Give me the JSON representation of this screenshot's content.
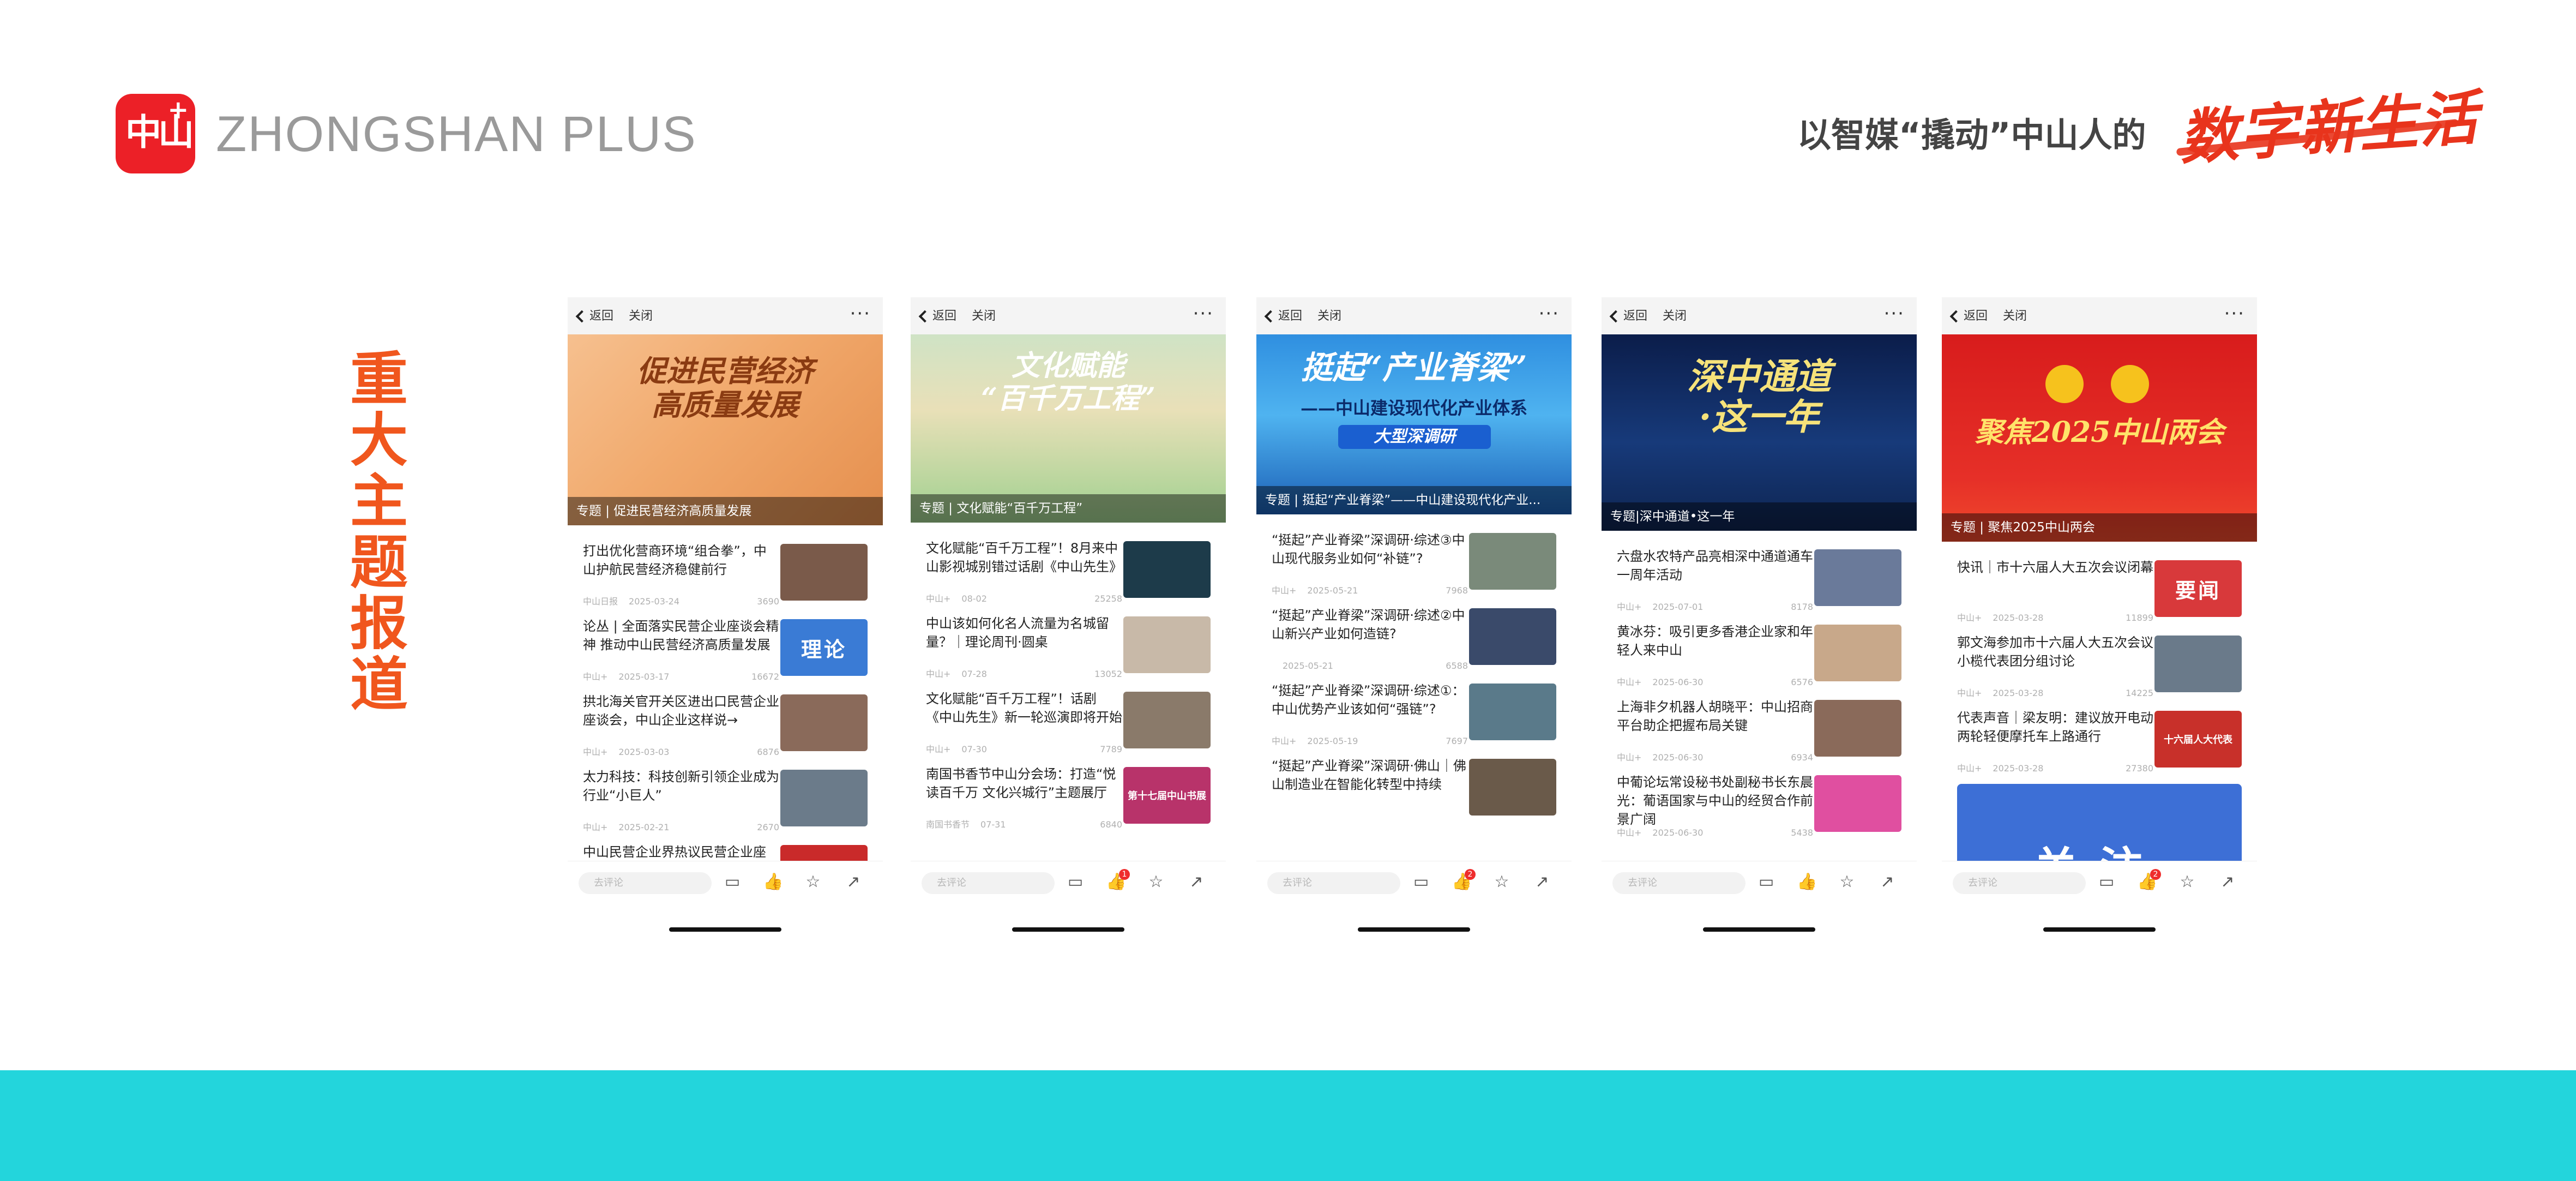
{
  "header": {
    "logo_text": "中山",
    "logo_plus": "+",
    "brand": "ZHONGSHAN PLUS",
    "slogan": "以智媒“撬动”中山人的",
    "slogan_art": "数字新生活"
  },
  "section_title": [
    "重",
    "大",
    "主",
    "题",
    "报",
    "道"
  ],
  "common": {
    "back": "返回",
    "close": "关闭",
    "more": "···",
    "comment_placeholder": "去评论"
  },
  "colors": {
    "accent": "#f0561d",
    "brand_red": "#ec2027",
    "band": "#23d5dc"
  },
  "phones": [
    {
      "banner_title": "促进民营经济\n高质量发展",
      "caption": "专题 | 促进民营经济高质量发展",
      "like_badge": "",
      "items": [
        {
          "title": "打出优化营商环境“组合拳”，中山护航民营经济稳健前行",
          "source": "中山日报",
          "date": "2025-03-24",
          "count": "3690",
          "thumb_label": ""
        },
        {
          "title": "论丛 | 全面落实民营企业座谈会精神 推动中山民营经济高质量发展",
          "source": "中山+",
          "date": "2025-03-17",
          "count": "16672",
          "thumb_label": "理论"
        },
        {
          "title": "拱北海关官开关区进出口民营企业座谈会，中山企业这样说→",
          "source": "中山+",
          "date": "2025-03-03",
          "count": "6876",
          "thumb_label": ""
        },
        {
          "title": "太力科技：科技创新引领企业成为行业“小巨人”",
          "source": "中山+",
          "date": "2025-02-21",
          "count": "2670",
          "thumb_label": ""
        },
        {
          "title": "中山民营企业界热议民营企业座",
          "source": "",
          "date": "",
          "count": "",
          "thumb_label": ""
        }
      ]
    },
    {
      "banner_title": "文化赋能\n“百千万工程”",
      "caption": "专题 | 文化赋能“百千万工程”",
      "like_badge": "1",
      "items": [
        {
          "title": "文化赋能“百千万工程”！8月来中山影视城别错过话剧《中山先生》",
          "source": "中山+",
          "date": "08-02",
          "count": "25258",
          "thumb_label": ""
        },
        {
          "title": "中山该如何化名人流量为名城留量？｜理论周刊·圆桌",
          "source": "中山+",
          "date": "07-28",
          "count": "13052",
          "thumb_label": ""
        },
        {
          "title": "文化赋能“百千万工程”！话剧《中山先生》新一轮巡演即将开始",
          "source": "中山+",
          "date": "07-30",
          "count": "7789",
          "thumb_label": ""
        },
        {
          "title": "南国书香节中山分会场：打造“悦读百千万 文化兴城行”主题展厅",
          "source": "南国书香节",
          "date": "07-31",
          "count": "6840",
          "thumb_label": "第十七届中山书展"
        }
      ]
    },
    {
      "banner_title": "挺起“产业脊梁”",
      "banner_sub": "——中山建设现代化产业体系",
      "banner_tag": "大型深调研",
      "caption": "专题 | 挺起“产业脊梁”——中山建设现代化产业...",
      "like_badge": "2",
      "items": [
        {
          "title": "“挺起”产业脊梁”深调研·综述③中山现代服务业如何“补链”?",
          "source": "中山+",
          "date": "2025-05-21",
          "count": "7968",
          "thumb_label": ""
        },
        {
          "title": "“挺起”产业脊梁”深调研·综述②中山新兴产业如何造链?",
          "source": "",
          "date": "2025-05-21",
          "count": "6588",
          "thumb_label": ""
        },
        {
          "title": "“挺起”产业脊梁”深调研·综述①：中山优势产业该如何“强链”?",
          "source": "中山+",
          "date": "2025-05-19",
          "count": "7697",
          "thumb_label": ""
        },
        {
          "title": "“挺起”产业脊梁”深调研·佛山｜佛山制造业在智能化转型中持续",
          "source": "",
          "date": "",
          "count": "",
          "thumb_label": ""
        }
      ]
    },
    {
      "banner_title": "深中通道\n·这一年",
      "caption": "专题|深中通道•这一年",
      "like_badge": "",
      "items": [
        {
          "title": "六盘水农特产品亮相深中通道通车一周年活动",
          "source": "中山+",
          "date": "2025-07-01",
          "count": "8178",
          "thumb_label": ""
        },
        {
          "title": "黄冰芬：吸引更多香港企业家和年轻人来中山",
          "source": "中山+",
          "date": "2025-06-30",
          "count": "6576",
          "thumb_label": ""
        },
        {
          "title": "上海非夕机器人胡晓平：中山招商平台助企把握布局关键",
          "source": "中山+",
          "date": "2025-06-30",
          "count": "6934",
          "thumb_label": ""
        },
        {
          "title": "中葡论坛常设秘书处副秘书长东晨光：葡语国家与中山的经贸合作前景广阔",
          "source": "中山+",
          "date": "2025-06-30",
          "count": "5438",
          "thumb_label": ""
        }
      ]
    },
    {
      "banner_title": "聚焦2025中山两会",
      "caption": "专题 | 聚焦2025中山两会",
      "like_badge": "2",
      "items": [
        {
          "title": "快讯｜市十六届人大五次会议闭幕",
          "source": "中山+",
          "date": "2025-03-28",
          "count": "11899",
          "thumb_label": "要闻"
        },
        {
          "title": "郭文海参加市十六届人大五次会议小榄代表团分组讨论",
          "source": "中山+",
          "date": "2025-03-28",
          "count": "14225",
          "thumb_label": ""
        },
        {
          "title": "代表声音｜梁友明：建议放开电动两轮轻便摩托车上路通行",
          "source": "中山+",
          "date": "2025-03-28",
          "count": "27380",
          "thumb_label": "十六届人大代表"
        }
      ],
      "big_card_label": "关注"
    }
  ]
}
